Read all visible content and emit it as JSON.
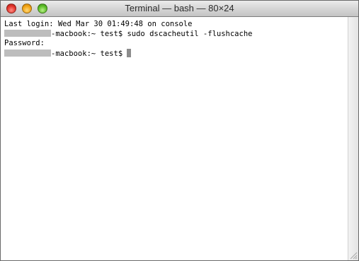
{
  "window": {
    "title": "Terminal — bash — 80×24"
  },
  "buttons": {
    "close_icon": "close-icon",
    "minimize_icon": "minimize-icon",
    "zoom_icon": "zoom-icon"
  },
  "terminal": {
    "line1": "Last login: Wed Mar 30 01:49:48 on console",
    "line2_prompt": "-macbook:~ test$ ",
    "line2_command": "sudo dscacheutil -flushcache",
    "line3": "Password:",
    "line4_prompt": "-macbook:~ test$ "
  },
  "colors": {
    "terminal_bg": "#ffffff",
    "terminal_text": "#000000",
    "redaction": "#bdbdbd",
    "cursor": "#8c8c8c"
  }
}
